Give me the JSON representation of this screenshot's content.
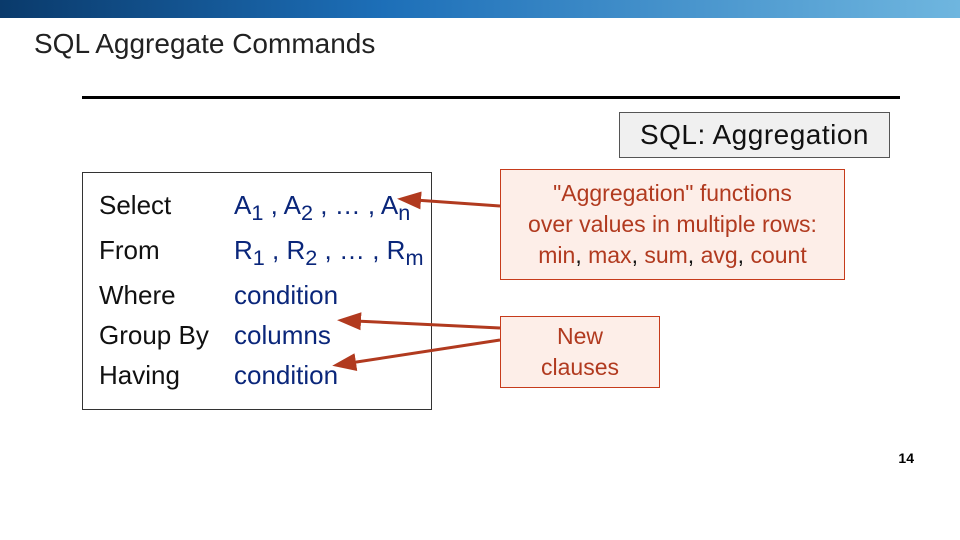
{
  "accent_bar_gradient": [
    "#0a3a6b",
    "#1d6fb8",
    "#6fb6df"
  ],
  "title": "SQL Aggregate Commands",
  "badge": "SQL: Aggregation",
  "sql": {
    "rows": [
      {
        "keyword": "Select",
        "arg_html": "A<sub>1</sub> , A<sub>2</sub> , … , A<sub>n</sub>"
      },
      {
        "keyword": "From",
        "arg_html": "R<sub>1</sub> , R<sub>2</sub> ,  … , R<sub>m</sub>"
      },
      {
        "keyword": "Where",
        "arg_html": "condition"
      },
      {
        "keyword": "Group By",
        "arg_html": "columns"
      },
      {
        "keyword": "Having",
        "arg_html": "condition"
      }
    ]
  },
  "callout_aggregation": {
    "line1": "\"Aggregation\" functions",
    "line2": "over values in multiple rows:",
    "functions": [
      "min",
      "max",
      "sum",
      "avg",
      "count"
    ]
  },
  "callout_newclauses": "New clauses",
  "page_number": "14"
}
